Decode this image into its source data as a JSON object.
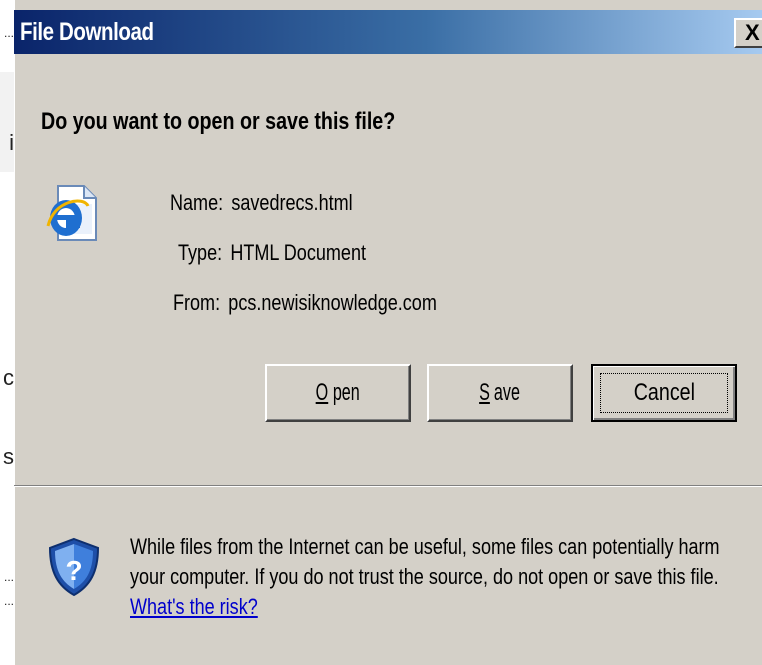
{
  "dialog": {
    "title": "File Download",
    "close_glyph": "X",
    "question": "Do you want to open or save this file?",
    "file_icon": "ie-html-document-icon",
    "details": [
      {
        "label": "Name:",
        "value": "savedrecs.html"
      },
      {
        "label": "Type:",
        "value": "HTML Document"
      },
      {
        "label": "From:",
        "value": "pcs.newisiknowledge.com"
      }
    ],
    "buttons": {
      "open_mnemonic": "O",
      "open_rest": "pen",
      "save_mnemonic": "S",
      "save_rest": "ave",
      "cancel_label": "Cancel"
    },
    "warning_icon": "security-shield-question-icon",
    "warning_text": "While files from the Internet can be useful, some files can potentially harm your computer. If you do not trust the source, do not open or save this file.",
    "warning_link": "What's the risk?"
  },
  "background": {
    "fragments": [
      "...",
      "i",
      "c",
      "s",
      "...",
      "..."
    ]
  },
  "colors": {
    "title_gradient_start": "#0a246a",
    "title_gradient_end": "#a6caf0",
    "dialog_face": "#d4d0c8",
    "link": "#0000cc"
  }
}
